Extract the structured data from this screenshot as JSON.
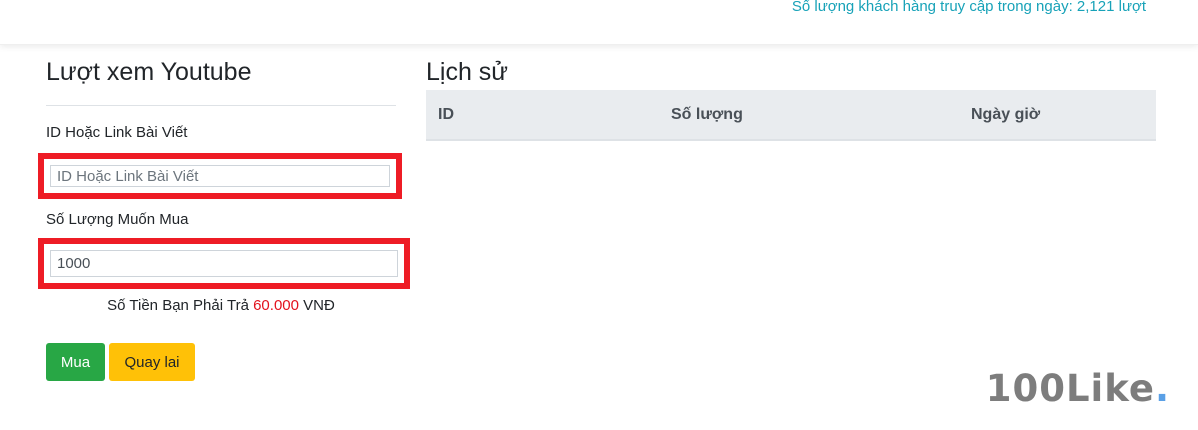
{
  "header": {
    "visitor_text": "Số lượng khách hàng truy cập trong ngày: 2,121 lượt"
  },
  "form": {
    "title": "Lượt xem Youtube",
    "id_label": "ID Hoặc Link Bài Viết",
    "id_placeholder": "ID Hoặc Link Bài Viết",
    "id_value": "",
    "quantity_label": "Số Lượng Muốn Mua",
    "quantity_value": "1000",
    "price_prefix": "Số Tiền Bạn Phải Trả",
    "price_amount": "60.000",
    "price_currency": "VNĐ",
    "buy_label": "Mua",
    "back_label": "Quay lai"
  },
  "history": {
    "title": "Lịch sử",
    "columns": [
      "ID",
      "Số lượng",
      "Ngày giờ"
    ],
    "rows": []
  },
  "brand": {
    "text": "100Like",
    "dot": "."
  },
  "colors": {
    "accent_teal": "#17a2b8",
    "highlight_red": "#ee1c25",
    "buy_green": "#28a745",
    "back_yellow": "#ffc107",
    "price_red": "#e3121d"
  }
}
